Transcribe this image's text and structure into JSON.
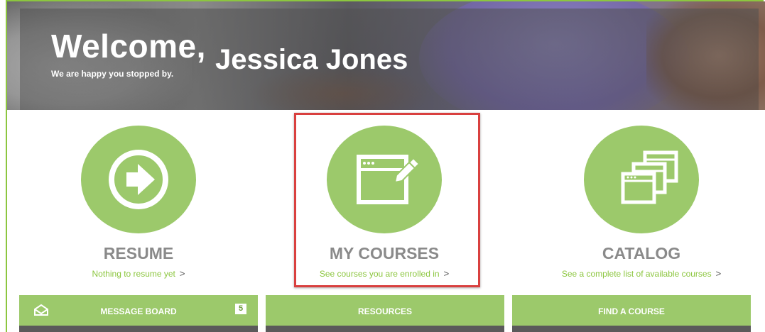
{
  "hero": {
    "greeting": "Welcome,",
    "user_name": "Jessica Jones",
    "tagline": "We are happy you stopped by."
  },
  "tiles": [
    {
      "title": "RESUME",
      "link": "Nothing to resume yet",
      "icon": "arrow-circle-icon"
    },
    {
      "title": "MY COURSES",
      "link": "See courses you are enrolled in",
      "icon": "window-edit-icon"
    },
    {
      "title": "CATALOG",
      "link": "See a complete list of available courses",
      "icon": "stacked-windows-icon"
    }
  ],
  "chevron": ">",
  "bars": [
    {
      "label": "MESSAGE BOARD",
      "icon": "envelope-icon",
      "badge": "5"
    },
    {
      "label": "RESOURCES"
    },
    {
      "label": "FIND A COURSE"
    }
  ],
  "colors": {
    "accent": "#9cc96b",
    "link": "#8cc63f",
    "title_gray": "#8a8a8a",
    "highlight": "#d9403f"
  }
}
